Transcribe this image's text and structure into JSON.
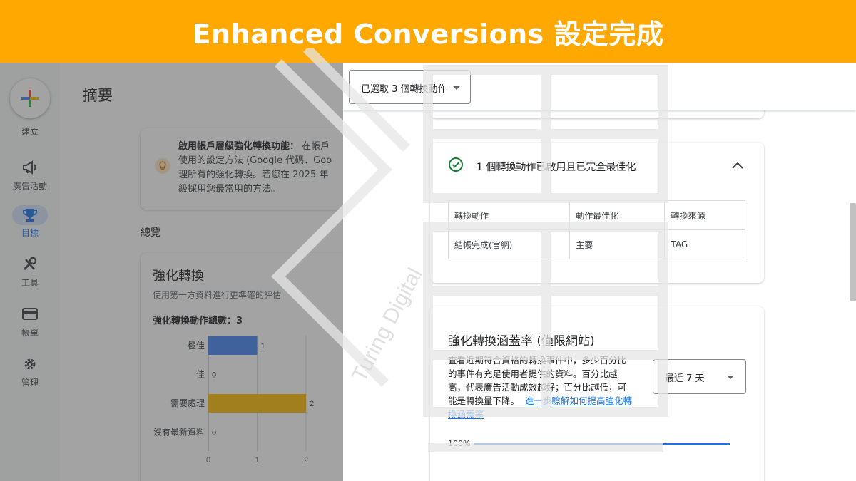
{
  "banner": {
    "title": "Enhanced Conversions 設定完成"
  },
  "nav": {
    "items": [
      {
        "label": "建立",
        "icon": "plus-icon"
      },
      {
        "label": "廣告活動",
        "icon": "megaphone-icon"
      },
      {
        "label": "目標",
        "icon": "trophy-icon",
        "active": true
      },
      {
        "label": "工具",
        "icon": "wrench-icon"
      },
      {
        "label": "帳單",
        "icon": "credit-card-icon"
      },
      {
        "label": "管理",
        "icon": "gear-icon"
      }
    ]
  },
  "summary": {
    "page_title": "摘要",
    "notice": {
      "heading": "啟用帳戶層級強化轉換功能：",
      "line1_rest": "在帳戶",
      "line2": "使用的設定方法 (Google 代碼、Goo",
      "line3": "理所有的強化轉換。若您在 2025 年",
      "line4": "級採用您最常用的方法。"
    },
    "overview_label": "總覽",
    "ec_card": {
      "title": "強化轉換",
      "subtitle": "使用第一方資料進行更準確的評估",
      "total_label": "強化轉換動作總數：3"
    }
  },
  "chart_data": {
    "type": "bar",
    "orientation": "horizontal",
    "categories": [
      "極佳",
      "佳",
      "需要處理",
      "沒有最新資料"
    ],
    "values": [
      1,
      0,
      2,
      0
    ],
    "colors": [
      "#4285f4",
      "#4285f4",
      "#fbbc04",
      "#fbbc04"
    ],
    "xticks": [
      0,
      1,
      2
    ],
    "xlim": [
      0,
      2
    ],
    "grid": true
  },
  "right": {
    "selector_label": "已選取 3 個轉換動作",
    "status_card": {
      "title": "1 個轉換動作已啟用且已完全最佳化",
      "table": {
        "headers": [
          "轉換動作",
          "動作最佳化",
          "轉換來源"
        ],
        "rows": [
          [
            "結帳完成(官網)",
            "主要",
            "TAG"
          ]
        ]
      }
    },
    "coverage_card": {
      "title": "強化轉換涵蓋率 (僅限網站)",
      "description_lines": [
        "查看近期符合資格的轉換事件中，多少百分比",
        "的事件有充足使用者提供的資料。百分比越",
        "高，代表廣告活動成效越好；百分比越低，可",
        "能是轉換量下降。"
      ],
      "link_lines": [
        "進一步瞭解如何提高強化轉",
        "換涵蓋率"
      ],
      "range_label": "最近 7 天",
      "pct_label": "100%"
    }
  },
  "watermark": {
    "text": "Turing Digital"
  },
  "colors": {
    "banner": "#ffa802",
    "accent": "#1a73e8",
    "success": "#188038"
  }
}
